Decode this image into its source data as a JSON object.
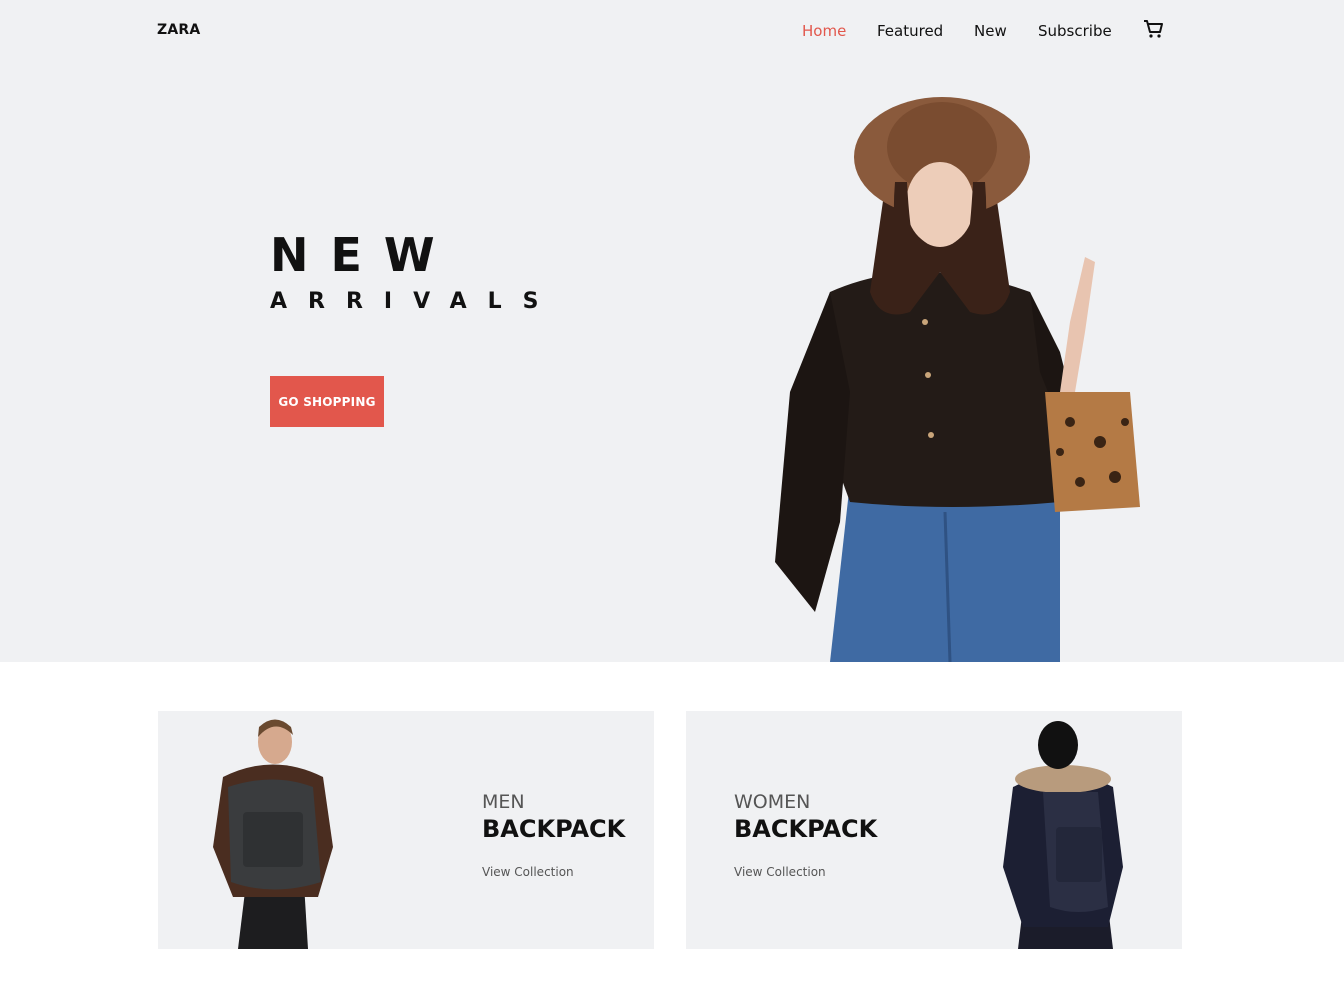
{
  "brand": {
    "logo_text": "ZARA",
    "accent_color": "#e2574c",
    "background_color": "#f0f1f3"
  },
  "nav": {
    "items": [
      {
        "label": "Home",
        "active": true
      },
      {
        "label": "Featured",
        "active": false
      },
      {
        "label": "New",
        "active": false
      },
      {
        "label": "Subscribe",
        "active": false
      }
    ],
    "cart_icon": "shopping-cart-icon"
  },
  "hero": {
    "headline_top": "NEW",
    "headline_bottom": "ARRIVALS",
    "cta_label": "GO SHOPPING",
    "image": "woman-in-hat-leather-jacket-with-leopard-bag"
  },
  "collections": [
    {
      "subtitle": "MEN",
      "title": "BACKPACK",
      "link_label": "View Collection",
      "image": "man-with-backpack"
    },
    {
      "subtitle": "WOMEN",
      "title": "BACKPACK",
      "link_label": "View Collection",
      "image": "woman-with-backpack"
    }
  ]
}
